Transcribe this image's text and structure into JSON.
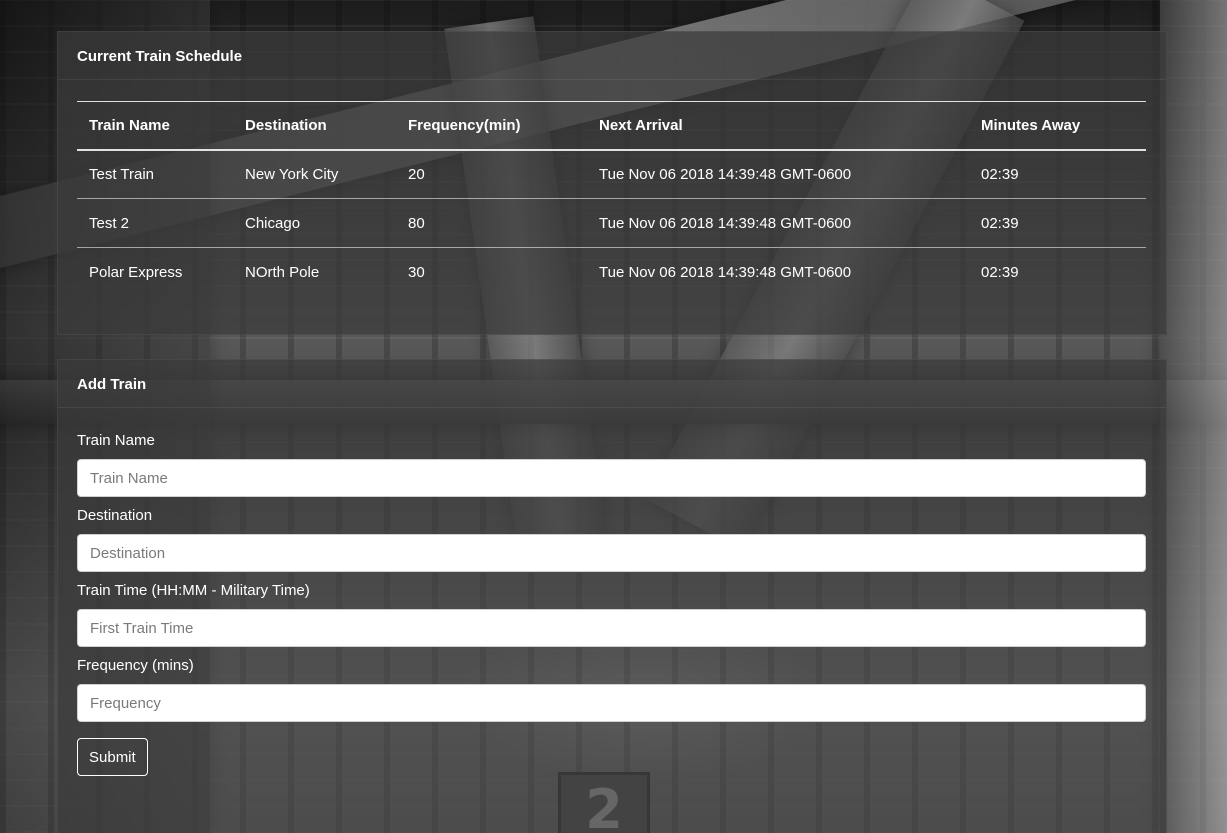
{
  "schedule": {
    "title": "Current Train Schedule",
    "columns": [
      "Train Name",
      "Destination",
      "Frequency(min)",
      "Next Arrival",
      "Minutes Away"
    ],
    "rows": [
      [
        "Test Train",
        "New York City",
        "20",
        "Tue Nov 06 2018 14:39:48 GMT-0600",
        "02:39"
      ],
      [
        "Test 2",
        "Chicago",
        "80",
        "Tue Nov 06 2018 14:39:48 GMT-0600",
        "02:39"
      ],
      [
        "Polar Express",
        "NOrth Pole",
        "30",
        "Tue Nov 06 2018 14:39:48 GMT-0600",
        "02:39"
      ]
    ]
  },
  "add_train": {
    "title": "Add Train",
    "fields": [
      {
        "label": "Train Name",
        "placeholder": "Train Name",
        "value": ""
      },
      {
        "label": "Destination",
        "placeholder": "Destination",
        "value": ""
      },
      {
        "label": "Train Time (HH:MM - Military Time)",
        "placeholder": "First Train Time",
        "value": ""
      },
      {
        "label": "Frequency (mins)",
        "placeholder": "Frequency",
        "value": ""
      }
    ],
    "submit_label": "Submit"
  },
  "background": {
    "platform_sign": "2"
  },
  "colors": {
    "card_bg": "#3a3a3a",
    "text": "#ffffff",
    "input_bg": "#ffffff"
  }
}
